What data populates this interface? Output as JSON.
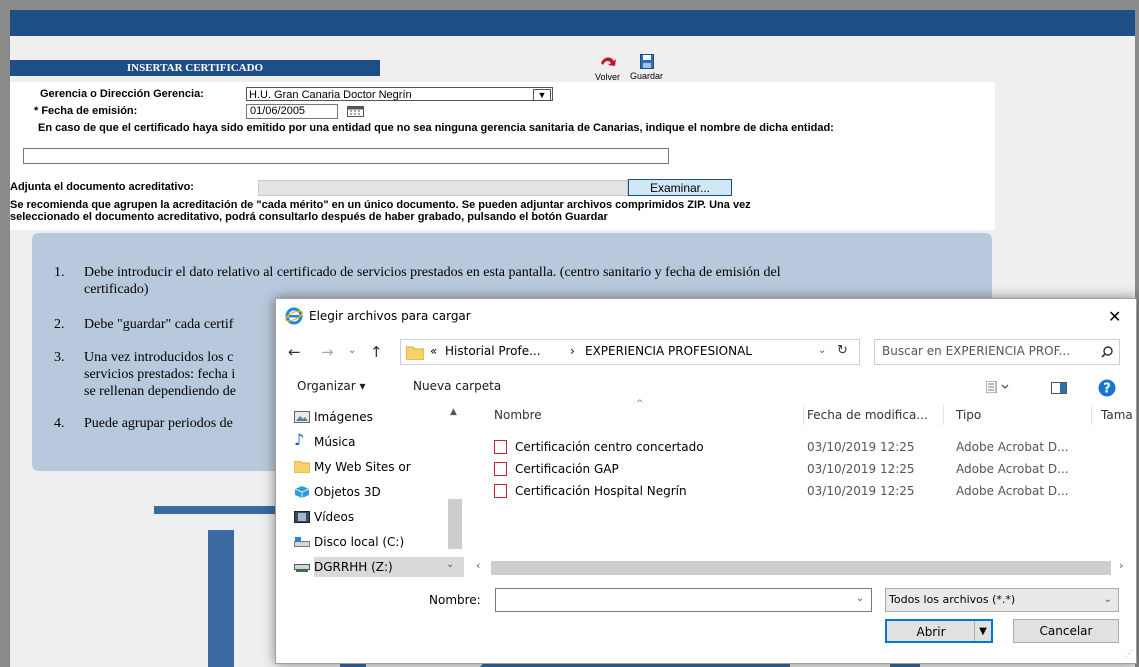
{
  "page": {
    "title": "INSERTAR CERTIFICADO",
    "toolbar": {
      "back_label": "Volver",
      "save_label": "Guardar"
    },
    "form": {
      "gerencia_label": "Gerencia o Dirección Gerencia:",
      "gerencia_value": "H.U. Gran Canaria Doctor Negrín",
      "fecha_label": "* Fecha de emisión:",
      "fecha_value": "01/06/2005",
      "entity_note": "En caso de que el certificado haya sido emitido por una entidad que no sea ninguna gerencia sanitaria de Canarias, indique el nombre de dicha entidad:",
      "entity_value": "",
      "attach_label": "Adjunta el documento acreditativo:",
      "browse_label": "Examinar...",
      "recommend_text_1": "Se recomienda que agrupen la acreditación de \"cada mérito\" en un único documento. Se pueden adjuntar archivos comprimidos ZIP. Una vez",
      "recommend_text_2": "seleccionado el documento acreditativo, podrá consultarlo después de haber grabado, pulsando el botón Guardar"
    },
    "notes": [
      {
        "num": "1.",
        "line1": "Debe introducir el dato relativo al certificado de servicios prestados en esta pantalla. (centro sanitario y fecha de emisión del",
        "line2": "certificado)"
      },
      {
        "num": "2.",
        "line1": "Debe \"guardar\" cada certif",
        "line2": ""
      },
      {
        "num": "3.",
        "line1": "Una vez introducidos los c",
        "line2": "servicios prestados: fecha i",
        "line3": "se rellenan dependiendo de"
      },
      {
        "num": "4.",
        "line1": "Puede agrupar periodos de",
        "line2": ""
      }
    ]
  },
  "dialog": {
    "title": "Elegir archivos para cargar",
    "close_label": "✕",
    "path": {
      "prefix": "«",
      "parts": [
        "Historial Profe...",
        "EXPERIENCIA PROFESIONAL"
      ],
      "separator": "›"
    },
    "search_placeholder": "Buscar en EXPERIENCIA PROF...",
    "organize_label": "Organizar ▾",
    "new_folder_label": "Nueva carpeta",
    "tree": [
      "Imágenes",
      "Música",
      "My Web Sites or",
      "Objetos 3D",
      "Vídeos",
      "Disco local (C:)",
      "DGRRHH (Z:)"
    ],
    "columns": {
      "name": "Nombre",
      "date": "Fecha de modifica...",
      "type": "Tipo",
      "size": "Tama"
    },
    "files": [
      {
        "name": "Certificación centro concertado",
        "date": "03/10/2019 12:25",
        "type": "Adobe Acrobat D..."
      },
      {
        "name": "Certificación GAP",
        "date": "03/10/2019 12:25",
        "type": "Adobe Acrobat D..."
      },
      {
        "name": "Certificación Hospital Negrín",
        "date": "03/10/2019 12:25",
        "type": "Adobe Acrobat D..."
      }
    ],
    "filename_label": "Nombre:",
    "filename_value": "",
    "filter_value": "Todos los archivos (*.*)",
    "open_label": "Abrir",
    "cancel_label": "Cancelar"
  },
  "colors": {
    "brand": "#1d4f86",
    "notes_bg": "#b9c9dd",
    "browse_bg": "#cfe8f4"
  }
}
